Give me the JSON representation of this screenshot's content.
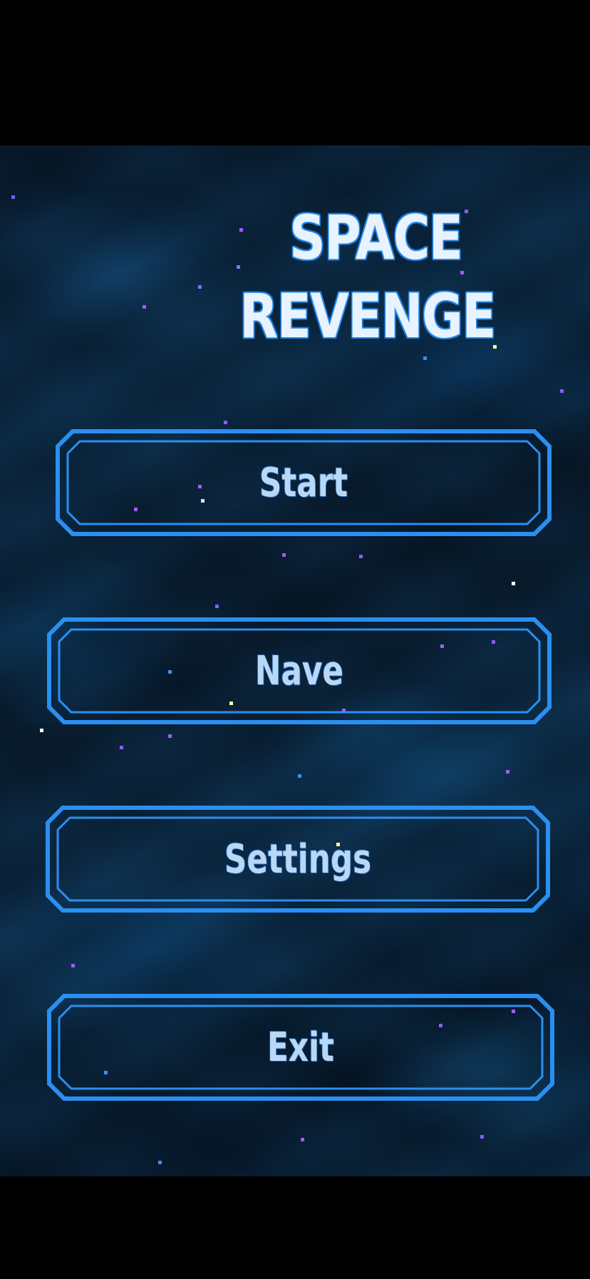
{
  "game": {
    "title_line1": "SPACE",
    "title_line2": "REVENGE"
  },
  "menu": {
    "start_label": "Start",
    "nave_label": "Nave",
    "settings_label": "Settings",
    "exit_label": "Exit"
  },
  "colors": {
    "button_border": "#2a8ff0",
    "label_text": "#b9d8f5",
    "background_dark": "#07182a",
    "background_light": "#0c2d4a"
  }
}
